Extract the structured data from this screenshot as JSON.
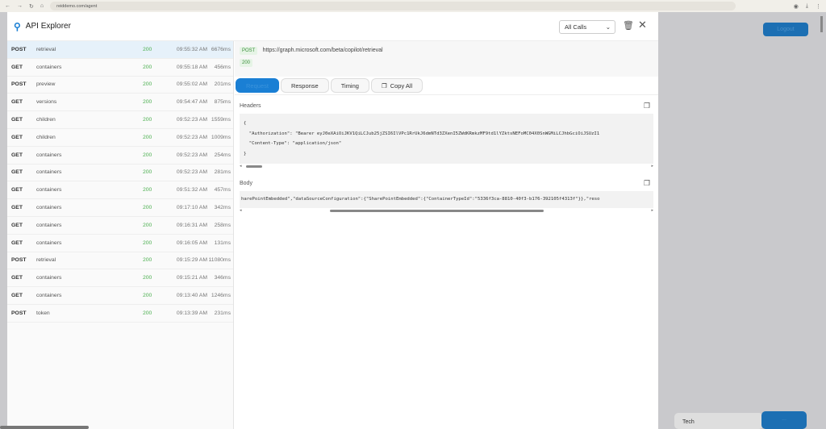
{
  "browser": {
    "url": "reiddemo.com/agent"
  },
  "header": {
    "title": "API Explorer",
    "filter": "All Calls"
  },
  "calls": [
    {
      "method": "POST",
      "path": "retrieval",
      "status": "200",
      "time": "09:55:32 AM",
      "duration": "6676ms"
    },
    {
      "method": "GET",
      "path": "containers",
      "status": "200",
      "time": "09:55:18 AM",
      "duration": "456ms"
    },
    {
      "method": "POST",
      "path": "preview",
      "status": "200",
      "time": "09:55:02 AM",
      "duration": "201ms"
    },
    {
      "method": "GET",
      "path": "versions",
      "status": "200",
      "time": "09:54:47 AM",
      "duration": "875ms"
    },
    {
      "method": "GET",
      "path": "children",
      "status": "200",
      "time": "09:52:23 AM",
      "duration": "1559ms"
    },
    {
      "method": "GET",
      "path": "children",
      "status": "200",
      "time": "09:52:23 AM",
      "duration": "1009ms"
    },
    {
      "method": "GET",
      "path": "containers",
      "status": "200",
      "time": "09:52:23 AM",
      "duration": "254ms"
    },
    {
      "method": "GET",
      "path": "containers",
      "status": "200",
      "time": "09:52:23 AM",
      "duration": "281ms"
    },
    {
      "method": "GET",
      "path": "containers",
      "status": "200",
      "time": "09:51:32 AM",
      "duration": "457ms"
    },
    {
      "method": "GET",
      "path": "containers",
      "status": "200",
      "time": "09:17:10 AM",
      "duration": "342ms"
    },
    {
      "method": "GET",
      "path": "containers",
      "status": "200",
      "time": "09:16:31 AM",
      "duration": "258ms"
    },
    {
      "method": "GET",
      "path": "containers",
      "status": "200",
      "time": "09:16:05 AM",
      "duration": "131ms"
    },
    {
      "method": "POST",
      "path": "retrieval",
      "status": "200",
      "time": "09:15:29 AM",
      "duration": "11080ms"
    },
    {
      "method": "GET",
      "path": "containers",
      "status": "200",
      "time": "09:15:21 AM",
      "duration": "346ms"
    },
    {
      "method": "GET",
      "path": "containers",
      "status": "200",
      "time": "09:13:40 AM",
      "duration": "1246ms"
    },
    {
      "method": "POST",
      "path": "token",
      "status": "200",
      "time": "09:13:39 AM",
      "duration": "231ms"
    }
  ],
  "detail": {
    "method": "POST",
    "url": "https://graph.microsoft.com/beta/copilot/retrieval",
    "status": "200",
    "tabs": [
      "Request",
      "Response",
      "Timing",
      "Copy All"
    ],
    "headers_label": "Headers",
    "headers_code": "{\n  \"Authorization\": \"Bearer eyJ0eXAiOiJKV1QiLCJub25jZSI6IlVPc1RrUkJ6dmNTd3ZXenI5ZWdKRmkzMF9td1lYZktsNEFoMC04X0SnWGMiLCJhbGciOiJSUzI1\n  \"Content-Type\": \"application/json\"\n}",
    "body_label": "Body",
    "body_code": "harePointEmbedded\",\"dataSourceConfiguration\":{\"SharePointEmbedded\":{\"ContainerTypeId\":\"5336f3ca-8810-40f3-b176-392105f4313f\"}},\"reso"
  },
  "background": {
    "logout": "Logout",
    "card_label": "Tech",
    "card_button": "..."
  }
}
